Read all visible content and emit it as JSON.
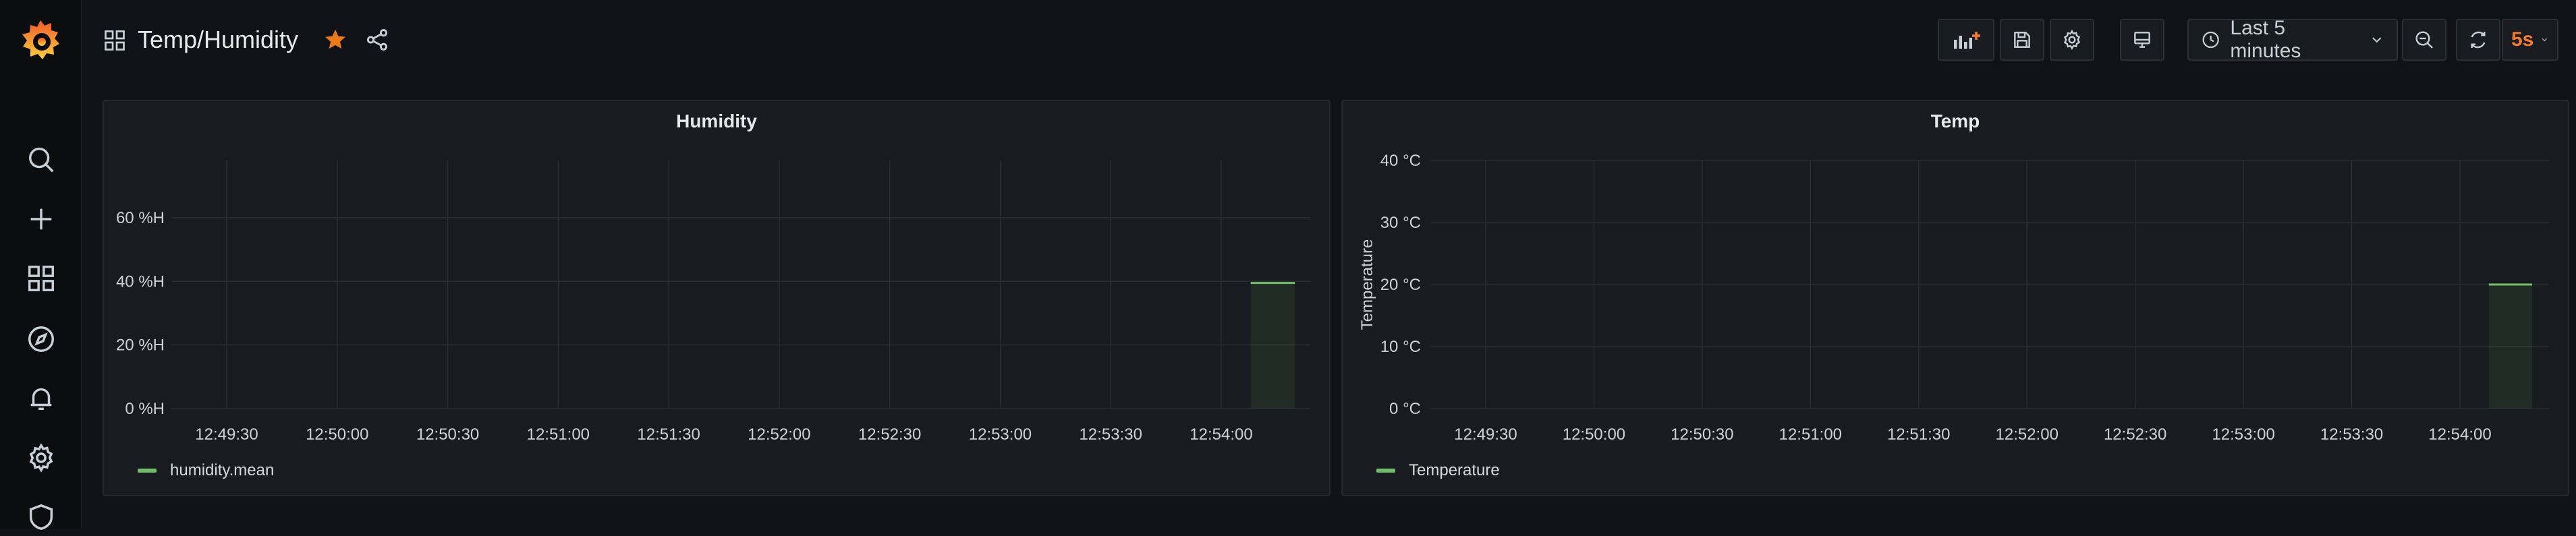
{
  "dashboard": {
    "title": "Temp/Humidity"
  },
  "toolbar": {
    "time_range": "Last 5 minutes",
    "refresh_interval": "5s"
  },
  "colors": {
    "accent": "#f57a2b",
    "series": "#73bf69",
    "background": "#111217",
    "panel": "#181b1f"
  },
  "icons": {
    "sidebar": [
      "grafana-logo-icon",
      "search-icon",
      "plus-icon",
      "dashboards-icon",
      "explore-icon",
      "alert-bell-icon",
      "gear-icon",
      "shield-icon"
    ],
    "toolbar": [
      "add-panel-icon",
      "save-icon",
      "settings-icon",
      "tv-icon",
      "clock-icon",
      "chevron-down-icon",
      "zoom-out-icon",
      "refresh-icon"
    ]
  },
  "panels": [
    {
      "title": "Humidity",
      "legend": "humidity.mean",
      "chart_data": {
        "type": "line",
        "title": "Humidity",
        "xlabel": "",
        "ylabel": "",
        "x": [
          "12:49:30",
          "12:50:00",
          "12:50:30",
          "12:51:00",
          "12:51:30",
          "12:52:00",
          "12:52:30",
          "12:53:00",
          "12:53:30",
          "12:54:00"
        ],
        "y_ticks": [
          "0 %H",
          "20 %H",
          "40 %H",
          "60 %H"
        ],
        "y_tick_values": [
          0,
          20,
          40,
          60
        ],
        "ylim": [
          0,
          78
        ],
        "grid": true,
        "legend_position": "bottom-left",
        "series": [
          {
            "name": "humidity.mean",
            "x": [
              "12:54:08",
              "12:54:20"
            ],
            "values": [
              39.5,
              39.5
            ]
          }
        ]
      }
    },
    {
      "title": "Temp",
      "legend": "Temperature",
      "chart_data": {
        "type": "line",
        "title": "Temp",
        "xlabel": "",
        "ylabel": "Temperature",
        "x": [
          "12:49:30",
          "12:50:00",
          "12:50:30",
          "12:51:00",
          "12:51:30",
          "12:52:00",
          "12:52:30",
          "12:53:00",
          "12:53:30",
          "12:54:00"
        ],
        "y_ticks": [
          "0 °C",
          "10 °C",
          "20 °C",
          "30 °C",
          "40 °C"
        ],
        "y_tick_values": [
          0,
          10,
          20,
          30,
          40
        ],
        "ylim": [
          0,
          40
        ],
        "grid": true,
        "legend_position": "bottom-left",
        "series": [
          {
            "name": "Temperature",
            "x": [
              "12:54:08",
              "12:54:20"
            ],
            "values": [
              20,
              20
            ]
          }
        ]
      }
    }
  ]
}
